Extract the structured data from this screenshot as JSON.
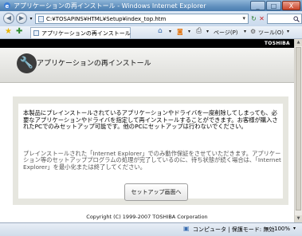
{
  "window": {
    "title": "アプリケーションの再インストール - Windows Internet Explorer",
    "minimize": "_",
    "maximize": "□",
    "close": "X"
  },
  "address": {
    "url": "C:¥TOSAPINS¥HTML¥Setup¥index_top.htm",
    "refresh": "↻",
    "stop": "✕"
  },
  "tab": {
    "label": "アプリケーションの再インストール"
  },
  "commands": {
    "page": "ページ(P)",
    "tools": "ツール(O)"
  },
  "page": {
    "brand": "TOSHIBA",
    "title": "アプリケーションの再インストール",
    "paragraph1": "本製品にプレインストールされているアプリケーションやドライバを一度削除してしまっても、必要なアプリケーションやドライバを指定して再インストールすることができます。お客様が購入されたPCでのみセットアップ可能です。他のPCにセットアップは行わないでください。",
    "paragraph2": "プレインストールされた「Internet Explorer」でのみ動作保証をさせていただきます。アプリケーション等のセットアッププログラムの処理が完了しているのに、待ち状態が続く場合は、「Internet Explorer」を最小化または終了してください。",
    "setup_button": "セットアップ画面へ",
    "copyright": "Copyright (C) 1999-2007 TOSHIBA Corporation"
  },
  "status": {
    "zone": "コンピュータ | 保護モード: 無効",
    "zoom": "100%"
  },
  "icons": {
    "back": "back-arrow-icon",
    "forward": "forward-arrow-icon",
    "favorites": "favorites-star-icon",
    "add_favorites": "add-favorites-icon",
    "home": "home-icon",
    "print": "print-icon",
    "wrench": "wrench-icon"
  },
  "colors": {
    "titlebar": "#5f8fbd",
    "brandbar": "#000000",
    "panel": "#e6e6df"
  }
}
